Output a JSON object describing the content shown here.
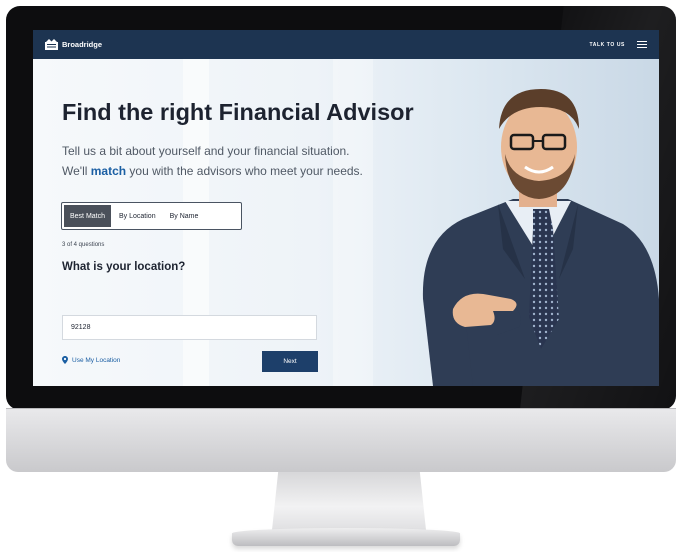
{
  "navbar": {
    "brand": "Broadridge",
    "talk_link": "TALK TO US",
    "menu_icon": "hamburger-menu-icon",
    "color": "#1d3451"
  },
  "hero": {
    "title": "Find the right Financial Advisor",
    "subtitle_line1": "Tell us a bit about yourself and your financial situation.",
    "subtitle_line2_prefix": "We'll ",
    "subtitle_line2_highlight": "match",
    "subtitle_line2_suffix": " you with the advisors who meet your needs."
  },
  "tabs": [
    {
      "label": "Best Match",
      "active": true
    },
    {
      "label": "By Location",
      "active": false
    },
    {
      "label": "By Name",
      "active": false
    }
  ],
  "form": {
    "progress": "3 of 4 questions",
    "question": "What is your location?",
    "location_value": "92128",
    "use_location": "Use My Location",
    "next": "Next"
  },
  "icons": {
    "brand_logo": "broadridge-logo-icon",
    "location": "map-pin-icon",
    "menu": "hamburger-menu-icon"
  },
  "colors": {
    "accent": "#1b5fa3",
    "next_button": "#1d3f6a",
    "active_tab": "#4a505a"
  }
}
